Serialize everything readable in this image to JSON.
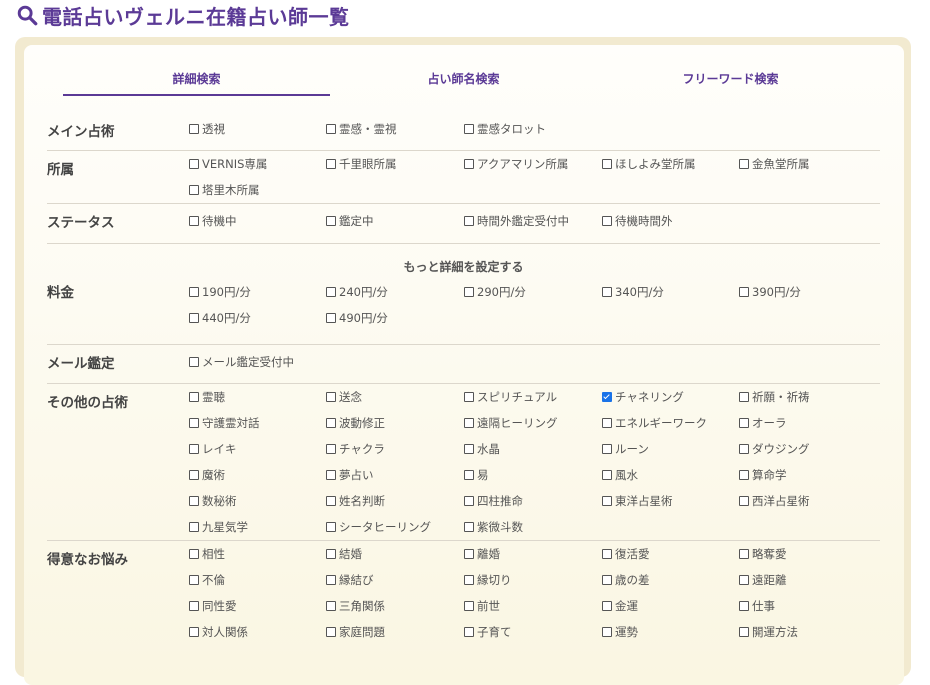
{
  "title": "電話占いヴェルニ在籍占い師一覧",
  "tabs": [
    "詳細検索",
    "占い師名検索",
    "フリーワード検索"
  ],
  "more_settings": "もっと詳細を設定する",
  "rows": [
    {
      "label": "メイン占術",
      "options": [
        {
          "text": "透視",
          "checked": false
        },
        {
          "text": "霊感・霊視",
          "checked": false
        },
        {
          "text": "霊感タロット",
          "checked": false
        }
      ]
    },
    {
      "label": "所属",
      "options": [
        {
          "text": "VERNIS専属",
          "checked": false
        },
        {
          "text": "千里眼所属",
          "checked": false
        },
        {
          "text": "アクアマリン所属",
          "checked": false
        },
        {
          "text": "ほしよみ堂所属",
          "checked": false
        },
        {
          "text": "金魚堂所属",
          "checked": false
        },
        {
          "text": "塔里木所属",
          "checked": false
        }
      ]
    },
    {
      "label": "ステータス",
      "options": [
        {
          "text": "待機中",
          "checked": false
        },
        {
          "text": "鑑定中",
          "checked": false
        },
        {
          "text": "時間外鑑定受付中",
          "checked": false
        },
        {
          "text": "待機時間外",
          "checked": false
        }
      ]
    },
    {
      "label": "料金",
      "options": [
        {
          "text": "190円/分",
          "checked": false
        },
        {
          "text": "240円/分",
          "checked": false
        },
        {
          "text": "290円/分",
          "checked": false
        },
        {
          "text": "340円/分",
          "checked": false
        },
        {
          "text": "390円/分",
          "checked": false
        },
        {
          "text": "440円/分",
          "checked": false
        },
        {
          "text": "490円/分",
          "checked": false
        }
      ]
    },
    {
      "label": "メール鑑定",
      "options": [
        {
          "text": "メール鑑定受付中",
          "checked": false
        }
      ]
    },
    {
      "label": "その他の占術",
      "options": [
        {
          "text": "霊聴",
          "checked": false
        },
        {
          "text": "送念",
          "checked": false
        },
        {
          "text": "スピリチュアル",
          "checked": false
        },
        {
          "text": "チャネリング",
          "checked": true
        },
        {
          "text": "祈願・祈祷",
          "checked": false
        },
        {
          "text": "守護霊対話",
          "checked": false
        },
        {
          "text": "波動修正",
          "checked": false
        },
        {
          "text": "遠隔ヒーリング",
          "checked": false
        },
        {
          "text": "エネルギーワーク",
          "checked": false
        },
        {
          "text": "オーラ",
          "checked": false
        },
        {
          "text": "レイキ",
          "checked": false
        },
        {
          "text": "チャクラ",
          "checked": false
        },
        {
          "text": "水晶",
          "checked": false
        },
        {
          "text": "ルーン",
          "checked": false
        },
        {
          "text": "ダウジング",
          "checked": false
        },
        {
          "text": "魔術",
          "checked": false
        },
        {
          "text": "夢占い",
          "checked": false
        },
        {
          "text": "易",
          "checked": false
        },
        {
          "text": "風水",
          "checked": false
        },
        {
          "text": "算命学",
          "checked": false
        },
        {
          "text": "数秘術",
          "checked": false
        },
        {
          "text": "姓名判断",
          "checked": false
        },
        {
          "text": "四柱推命",
          "checked": false
        },
        {
          "text": "東洋占星術",
          "checked": false
        },
        {
          "text": "西洋占星術",
          "checked": false
        },
        {
          "text": "九星気学",
          "checked": false
        },
        {
          "text": "シータヒーリング",
          "checked": false
        },
        {
          "text": "紫微斗数",
          "checked": false
        }
      ]
    },
    {
      "label": "得意なお悩み",
      "options": [
        {
          "text": "相性",
          "checked": false
        },
        {
          "text": "結婚",
          "checked": false
        },
        {
          "text": "離婚",
          "checked": false
        },
        {
          "text": "復活愛",
          "checked": false
        },
        {
          "text": "略奪愛",
          "checked": false
        },
        {
          "text": "不倫",
          "checked": false
        },
        {
          "text": "縁結び",
          "checked": false
        },
        {
          "text": "縁切り",
          "checked": false
        },
        {
          "text": "歳の差",
          "checked": false
        },
        {
          "text": "遠距離",
          "checked": false
        },
        {
          "text": "同性愛",
          "checked": false
        },
        {
          "text": "三角関係",
          "checked": false
        },
        {
          "text": "前世",
          "checked": false
        },
        {
          "text": "金運",
          "checked": false
        },
        {
          "text": "仕事",
          "checked": false
        },
        {
          "text": "対人関係",
          "checked": false
        },
        {
          "text": "家庭問題",
          "checked": false
        },
        {
          "text": "子育て",
          "checked": false
        },
        {
          "text": "運勢",
          "checked": false
        },
        {
          "text": "開運方法",
          "checked": false
        }
      ]
    }
  ]
}
